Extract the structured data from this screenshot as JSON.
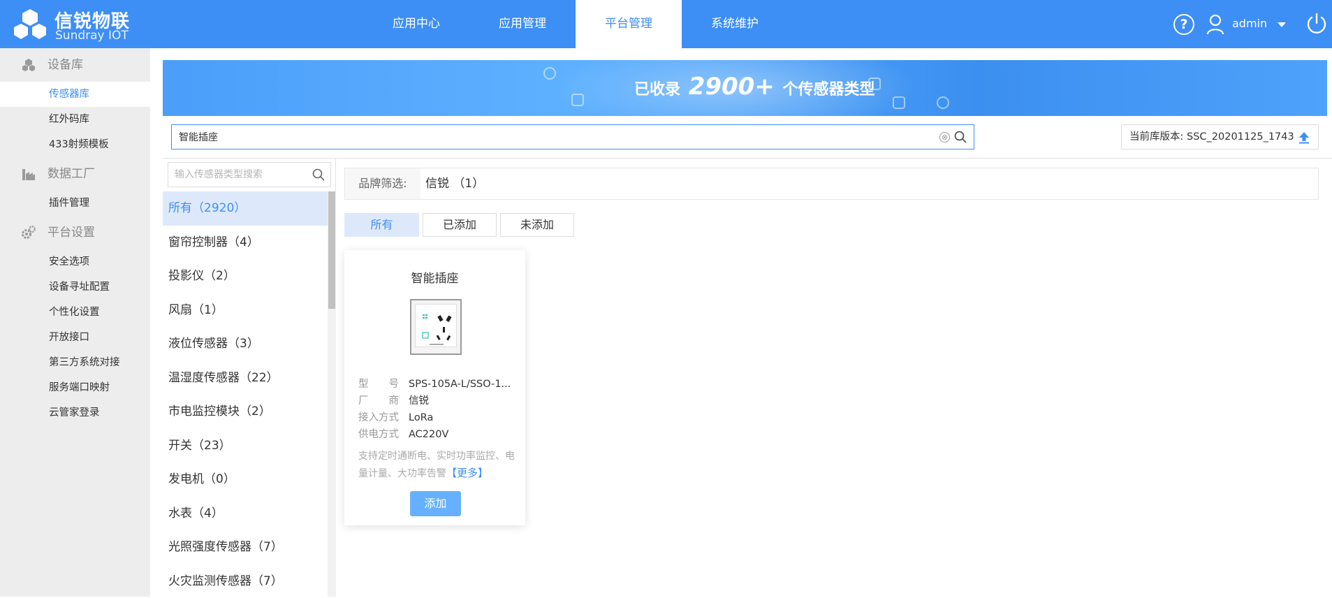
{
  "header": {
    "logo_cn": "信锐物联",
    "logo_en": "Sundray IOT",
    "nav": [
      {
        "label": "应用中心"
      },
      {
        "label": "应用管理"
      },
      {
        "label": "平台管理"
      },
      {
        "label": "系统维护"
      }
    ],
    "active_nav": "平台管理",
    "help_glyph": "?",
    "username": "admin",
    "accent_color": "#3d8ef5"
  },
  "sidebar": {
    "groups": [
      {
        "label": "设备库",
        "items": [
          "传感器库",
          "红外码库",
          "433射频模板"
        ]
      },
      {
        "label": "数据工厂",
        "items": [
          "插件管理"
        ]
      },
      {
        "label": "平台设置",
        "items": [
          "安全选项",
          "设备寻址配置",
          "个性化设置",
          "开放接口",
          "第三方系统对接",
          "服务端口映射",
          "云管家登录"
        ]
      }
    ],
    "active_item": "传感器库"
  },
  "banner": {
    "prefix": "已收录",
    "count": "2900+",
    "suffix": "个传感器类型"
  },
  "search": {
    "value": "智能插座",
    "clear_glyph": "⊗"
  },
  "version": {
    "label": "当前库版本: SSC_20201125_1743"
  },
  "categories": {
    "search_placeholder": "输入传感器类型搜索",
    "items": [
      "所有（2920）",
      "窗帘控制器（4）",
      "投影仪（2）",
      "风扇（1）",
      "液位传感器（3）",
      "温湿度传感器（22）",
      "市电监控模块（2）",
      "开关（23）",
      "发电机（0）",
      "水表（4）",
      "光照强度传感器（7）",
      "火灾监测传感器（7）"
    ],
    "active_index": 0
  },
  "brand_filter": {
    "label": "品牌筛选:",
    "value": "信锐 （1）"
  },
  "filter_tabs": [
    "所有",
    "已添加",
    "未添加"
  ],
  "active_filter": "所有",
  "card": {
    "title": "智能插座",
    "specs": [
      {
        "key": "型　　号",
        "value": "SPS-105A-L/SSO-1..."
      },
      {
        "key": "厂　　商",
        "value": "信锐"
      },
      {
        "key": "接入方式",
        "value": "LoRa"
      },
      {
        "key": "供电方式",
        "value": "AC220V"
      }
    ],
    "description": "支持定时通断电、实时功率监控、电量计量、大功率告警",
    "more_label": "【更多】",
    "add_label": "添加"
  }
}
